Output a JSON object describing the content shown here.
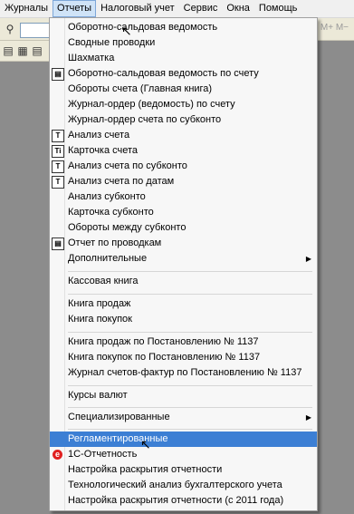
{
  "menubar": {
    "items": [
      "Журналы",
      "Отчеты",
      "Налоговый учет",
      "Сервис",
      "Окна",
      "Помощь"
    ]
  },
  "toolbar": {
    "right_text": "M+ M−",
    "icons": [
      "binoculars-icon",
      "document-icon",
      "document2-icon",
      "document3-icon"
    ]
  },
  "menu": {
    "items": [
      {
        "label": "Оборотно-сальдовая ведомость",
        "icon": "none"
      },
      {
        "label": "Сводные проводки",
        "icon": "none"
      },
      {
        "label": "Шахматка",
        "icon": "none"
      },
      {
        "label": "Оборотно-сальдовая ведомость по счету",
        "icon": "report"
      },
      {
        "label": "Обороты счета (Главная книга)",
        "icon": "none"
      },
      {
        "label": "Журнал-ордер (ведомость) по счету",
        "icon": "none"
      },
      {
        "label": "Журнал-ордер счета по субконто",
        "icon": "none"
      },
      {
        "label": "Анализ счета",
        "icon": "T"
      },
      {
        "label": "Карточка счета",
        "icon": "Ti"
      },
      {
        "label": "Анализ счета по субконто",
        "icon": "T"
      },
      {
        "label": "Анализ счета по датам",
        "icon": "T"
      },
      {
        "label": "Анализ субконто",
        "icon": "none"
      },
      {
        "label": "Карточка субконто",
        "icon": "none"
      },
      {
        "label": "Обороты между субконто",
        "icon": "none"
      },
      {
        "label": "Отчет по проводкам",
        "icon": "report"
      },
      {
        "label": "Дополнительные",
        "icon": "none",
        "submenu": true
      },
      {
        "label": "Кассовая книга",
        "icon": "none"
      },
      {
        "label": "Книга продаж",
        "icon": "none"
      },
      {
        "label": "Книга покупок",
        "icon": "none"
      },
      {
        "label": "Книга продаж по Постановлению № 1137",
        "icon": "none"
      },
      {
        "label": "Книга покупок по Постановлению № 1137",
        "icon": "none"
      },
      {
        "label": "Журнал счетов-фактур по Постановлению № 1137",
        "icon": "none"
      },
      {
        "label": "Курсы валют",
        "icon": "none"
      },
      {
        "label": "Специализированные",
        "icon": "none",
        "submenu": true
      },
      {
        "label": "Регламентированные",
        "icon": "none",
        "highlighted": true
      },
      {
        "label": "1С-Отчетность",
        "icon": "red"
      },
      {
        "label": "Настройка раскрытия отчетности",
        "icon": "none"
      },
      {
        "label": "Технологический анализ бухгалтерского учета",
        "icon": "none"
      },
      {
        "label": "Настройка раскрытия отчетности (с 2011 года)",
        "icon": "none"
      }
    ]
  }
}
